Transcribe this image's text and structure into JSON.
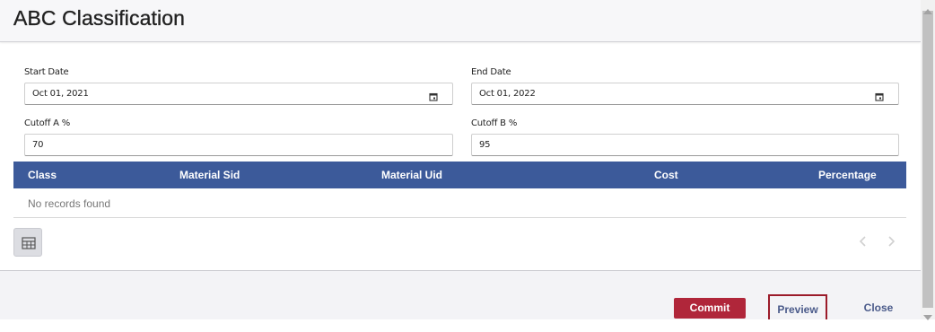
{
  "dialog": {
    "title": "ABC Classification"
  },
  "form": {
    "start_date": {
      "label": "Start Date",
      "value": "Oct 01, 2021",
      "icon": "calendar-icon"
    },
    "end_date": {
      "label": "End Date",
      "value": "Oct 01, 2022",
      "icon": "calendar-icon"
    },
    "cutoff_a": {
      "label": "Cutoff A %",
      "value": "70"
    },
    "cutoff_b": {
      "label": "Cutoff B %",
      "value": "95"
    }
  },
  "table": {
    "columns": [
      "Class",
      "Material Sid",
      "Material Uid",
      "Cost",
      "Percentage"
    ],
    "rows": [],
    "empty_message": "No records found",
    "header_color": "#3c5a9a"
  },
  "toolbar": {
    "grid_icon": "table-grid-icon",
    "pager_prev_icon": "chevron-left-icon",
    "pager_next_icon": "chevron-right-icon"
  },
  "footer": {
    "commit_label": "Commit",
    "preview_label": "Preview",
    "close_label": "Close",
    "commit_color": "#b0263a"
  }
}
